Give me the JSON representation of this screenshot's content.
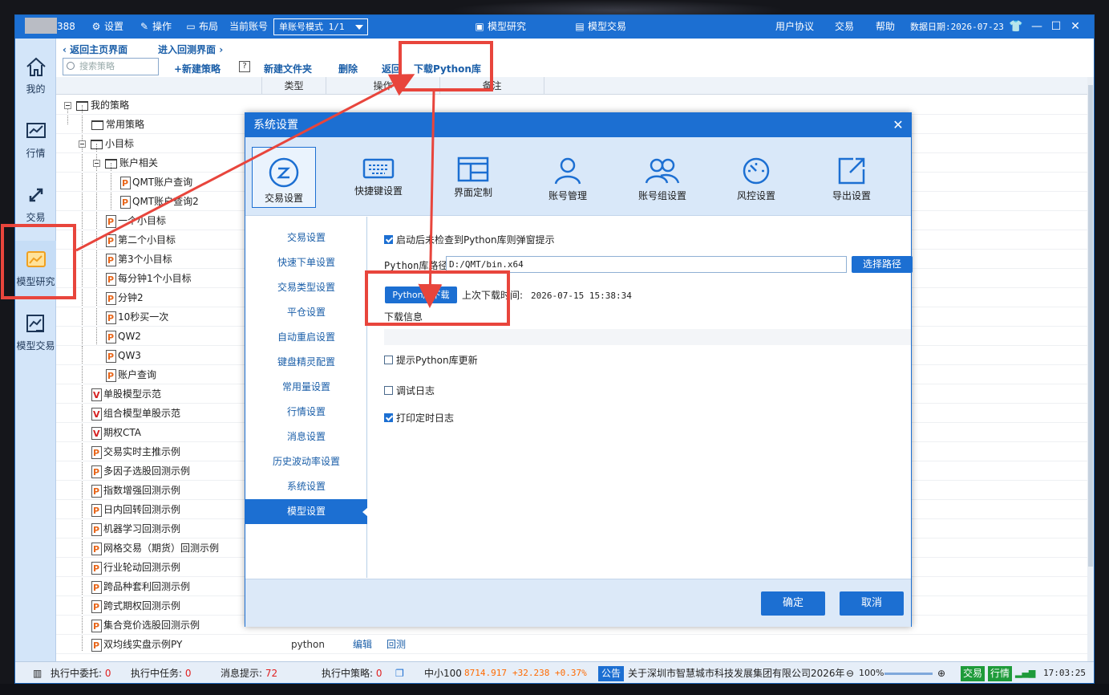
{
  "titlebar": {
    "account_fragment": "388",
    "settings": "设置",
    "operate": "操作",
    "layout": "布局",
    "current_account_label": "当前账号",
    "account_mode": "单账号模式 1/1",
    "model_research": "模型研究",
    "model_trading": "模型交易",
    "user_agreement": "用户协议",
    "trade": "交易",
    "help": "帮助",
    "data_date": "数据日期:2026-07-23"
  },
  "leftnav": {
    "items": [
      {
        "label": "我的",
        "icon": "home-icon"
      },
      {
        "label": "行情",
        "icon": "chart-icon"
      },
      {
        "label": "交易",
        "icon": "exchange-icon"
      },
      {
        "label": "模型研究",
        "icon": "research-icon"
      },
      {
        "label": "模型交易",
        "icon": "model-trade-icon"
      }
    ]
  },
  "toolbar": {
    "back_home": "返回主页界面",
    "enter_backtest": "进入回测界面",
    "search_placeholder": "搜索策略",
    "new_strategy": "+新建策略",
    "help_box": "?",
    "new_folder": "新建文件夹",
    "delete": "删除",
    "return_fragment": "返回",
    "download_python": "下载Python库"
  },
  "columns": {
    "type": "类型",
    "operate": "操作",
    "remark": "备注"
  },
  "tree": {
    "my_strategies": "我的策略",
    "common": "常用策略",
    "small_goal": "小目标",
    "account_related": "账户相关",
    "items": [
      "QMT账户查询",
      "QMT账户查询2",
      "一个小目标",
      "第二个小目标",
      "第3个小目标",
      "每分钟1个小目标",
      "分钟2",
      "10秒买一次",
      "QW2",
      "QW3",
      "账户查询",
      "单股模型示范",
      "组合模型单股示范",
      "期权CTA",
      "交易实时主推示例",
      "多因子选股回测示例",
      "指数增强回测示例",
      "日内回转回测示例",
      "机器学习回测示例",
      "网格交易（期货）回测示例",
      "行业轮动回测示例",
      "跨品种套利回测示例",
      "跨式期权回测示例",
      "集合竞价选股回测示例",
      "双均线实盘示例PY"
    ],
    "last_row": {
      "type": "python",
      "edit": "编辑",
      "backtest": "回测"
    }
  },
  "dialog": {
    "title": "系统设置",
    "tabs": [
      "交易设置",
      "快捷键设置",
      "界面定制",
      "账号管理",
      "账号组设置",
      "风控设置",
      "导出设置"
    ],
    "side_items": [
      "交易设置",
      "快速下单设置",
      "交易类型设置",
      "平仓设置",
      "自动重启设置",
      "键盘精灵配置",
      "常用量设置",
      "行情设置",
      "消息设置",
      "历史波动率设置",
      "系统设置",
      "模型设置"
    ],
    "check_on_start": "启动后未检查到Python库则弹窗提示",
    "path_label": "Python库路径",
    "path_value": "D:/QMT/bin.x64",
    "choose_path": "选择路径",
    "download_button": "Python库下载",
    "last_download_label": "上次下载时间:",
    "last_download_time": "2026-07-15 15:38:34",
    "download_info": "下载信息",
    "prompt_update": "提示Python库更新",
    "debug_log": "调试日志",
    "print_timer_log": "打印定时日志",
    "ok": "确定",
    "cancel": "取消"
  },
  "statusbar": {
    "exec_orders_label": "执行中委托:",
    "exec_orders": "0",
    "exec_tasks_label": "执行中任务:",
    "exec_tasks": "0",
    "msg_label": "消息提示:",
    "msg_count": "72",
    "exec_strategy_label": "执行中策略:",
    "exec_strategy": "0",
    "index_name": "中小100",
    "index_value": "8714.917",
    "index_change": "+32.238",
    "index_pct": "+0.37%",
    "announce": "公告",
    "announce_text": "关于深圳市智慧城市科技发展集团有限公司2026年",
    "zoom": "100%",
    "trade_tag": "交易",
    "quote_tag": "行情",
    "time": "17:03:25"
  },
  "colors": {
    "brand": "#1c6fd2",
    "highlight": "#e8453c"
  }
}
